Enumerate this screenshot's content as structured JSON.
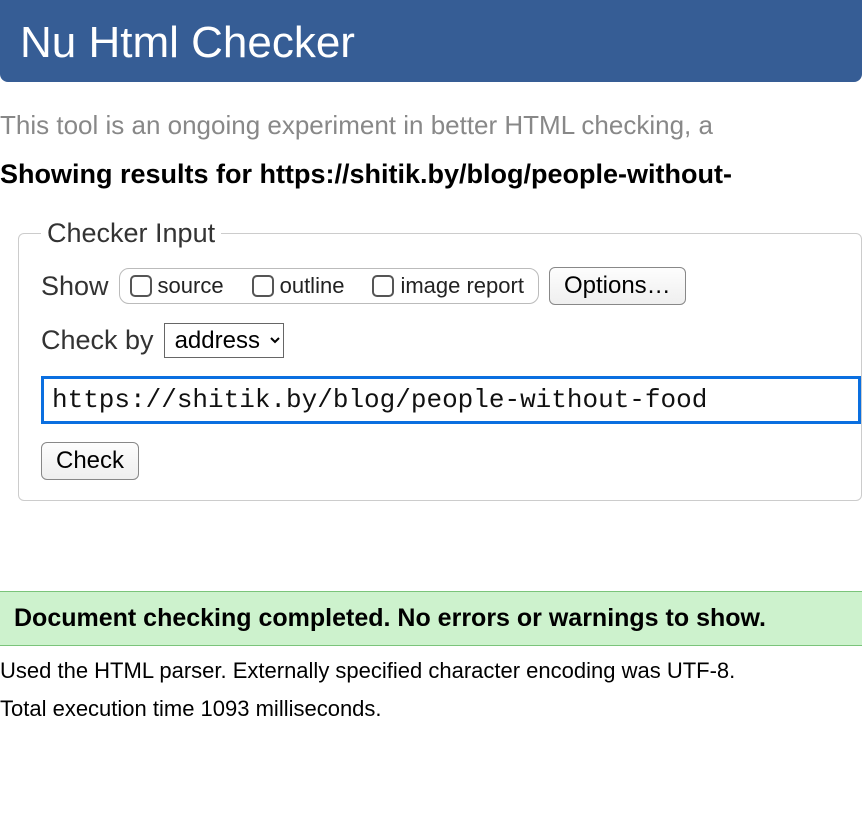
{
  "header": {
    "title": "Nu Html Checker"
  },
  "intro": "This tool is an ongoing experiment in better HTML checking, a",
  "results_heading": "Showing results for https://shitik.by/blog/people-without-",
  "fieldset": {
    "legend": "Checker Input",
    "show_label": "Show",
    "checkboxes": {
      "source": "source",
      "outline": "outline",
      "image_report": "image report"
    },
    "options_button": "Options…",
    "checkby_label": "Check by",
    "checkby_options": [
      "address"
    ],
    "checkby_selected": "address",
    "url_value": "https://shitik.by/blog/people-without-food",
    "check_button": "Check"
  },
  "success_message": "Document checking completed. No errors or warnings to show.",
  "parser_line": "Used the HTML parser. Externally specified character encoding was UTF-8.",
  "timing_line": "Total execution time 1093 milliseconds."
}
